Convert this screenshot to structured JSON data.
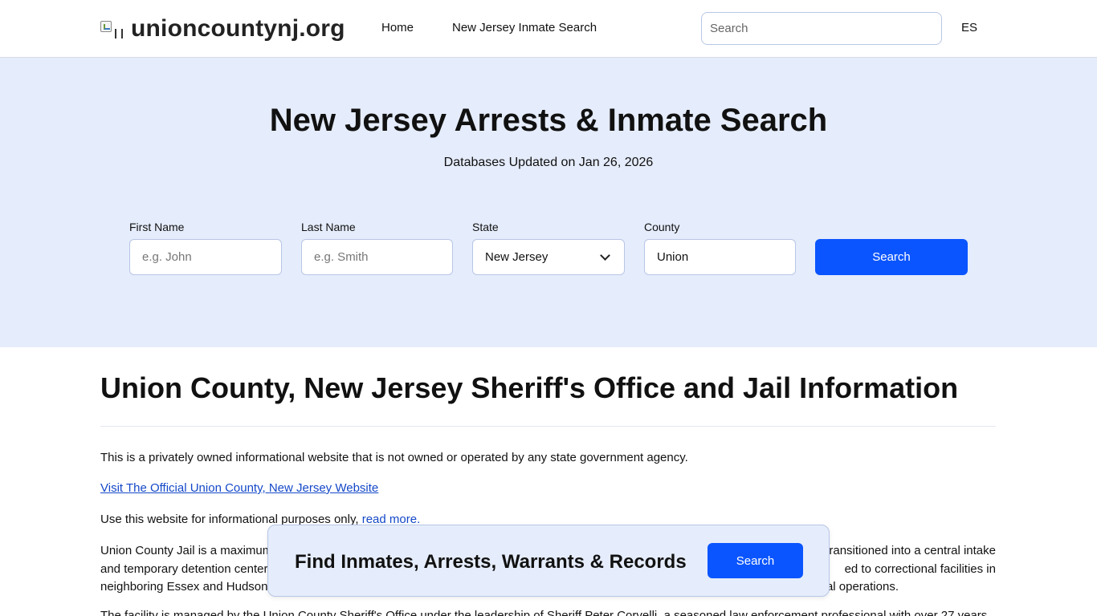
{
  "header": {
    "site_name": "unioncountynj.org",
    "nav": [
      {
        "label": "Home"
      },
      {
        "label": "New Jersey Inmate Search"
      }
    ],
    "search_placeholder": "Search",
    "language": "ES"
  },
  "hero": {
    "title": "New Jersey Arrests & Inmate Search",
    "subtitle": "Databases Updated on Jan 26, 2026",
    "form": {
      "first_name": {
        "label": "First Name",
        "placeholder": "e.g. John",
        "value": ""
      },
      "last_name": {
        "label": "Last Name",
        "placeholder": "e.g. Smith",
        "value": ""
      },
      "state": {
        "label": "State",
        "value": "New Jersey"
      },
      "county": {
        "label": "County",
        "value": "Union"
      },
      "submit_label": "Search"
    }
  },
  "content": {
    "title": "Union County, New Jersey Sheriff's Office and Jail Information",
    "disclaimer": "This is a privately owned informational website that is not owned or operated by any state government agency.",
    "official_link": "Visit The Official Union County, New Jersey Website",
    "informational_prefix": "Use this website for informational purposes only,",
    "read_more": "read more.",
    "para_jail_line1_left": "Union County Jail is a maximum",
    "para_jail_line1_right": "ransitioned into a central intake",
    "para_jail_line2_left": "and temporary detention center",
    "para_jail_line2_right": "ed to correctional facilities in",
    "para_jail_line3_left": "neighboring Essex and Hudson",
    "para_jail_line3_right": "al operations.",
    "para_next": "The facility is managed by the Union County Sheriff's Office under the leadership of Sheriff Peter Corvelli, a seasoned law enforcement professional with over 27 years"
  },
  "floating_banner": {
    "text": "Find Inmates, Arrests, Warrants & Records",
    "button_label": "Search"
  },
  "colors": {
    "accent": "#0a55ff",
    "hero_bg": "#e5ecfb",
    "link": "#1448c8"
  }
}
